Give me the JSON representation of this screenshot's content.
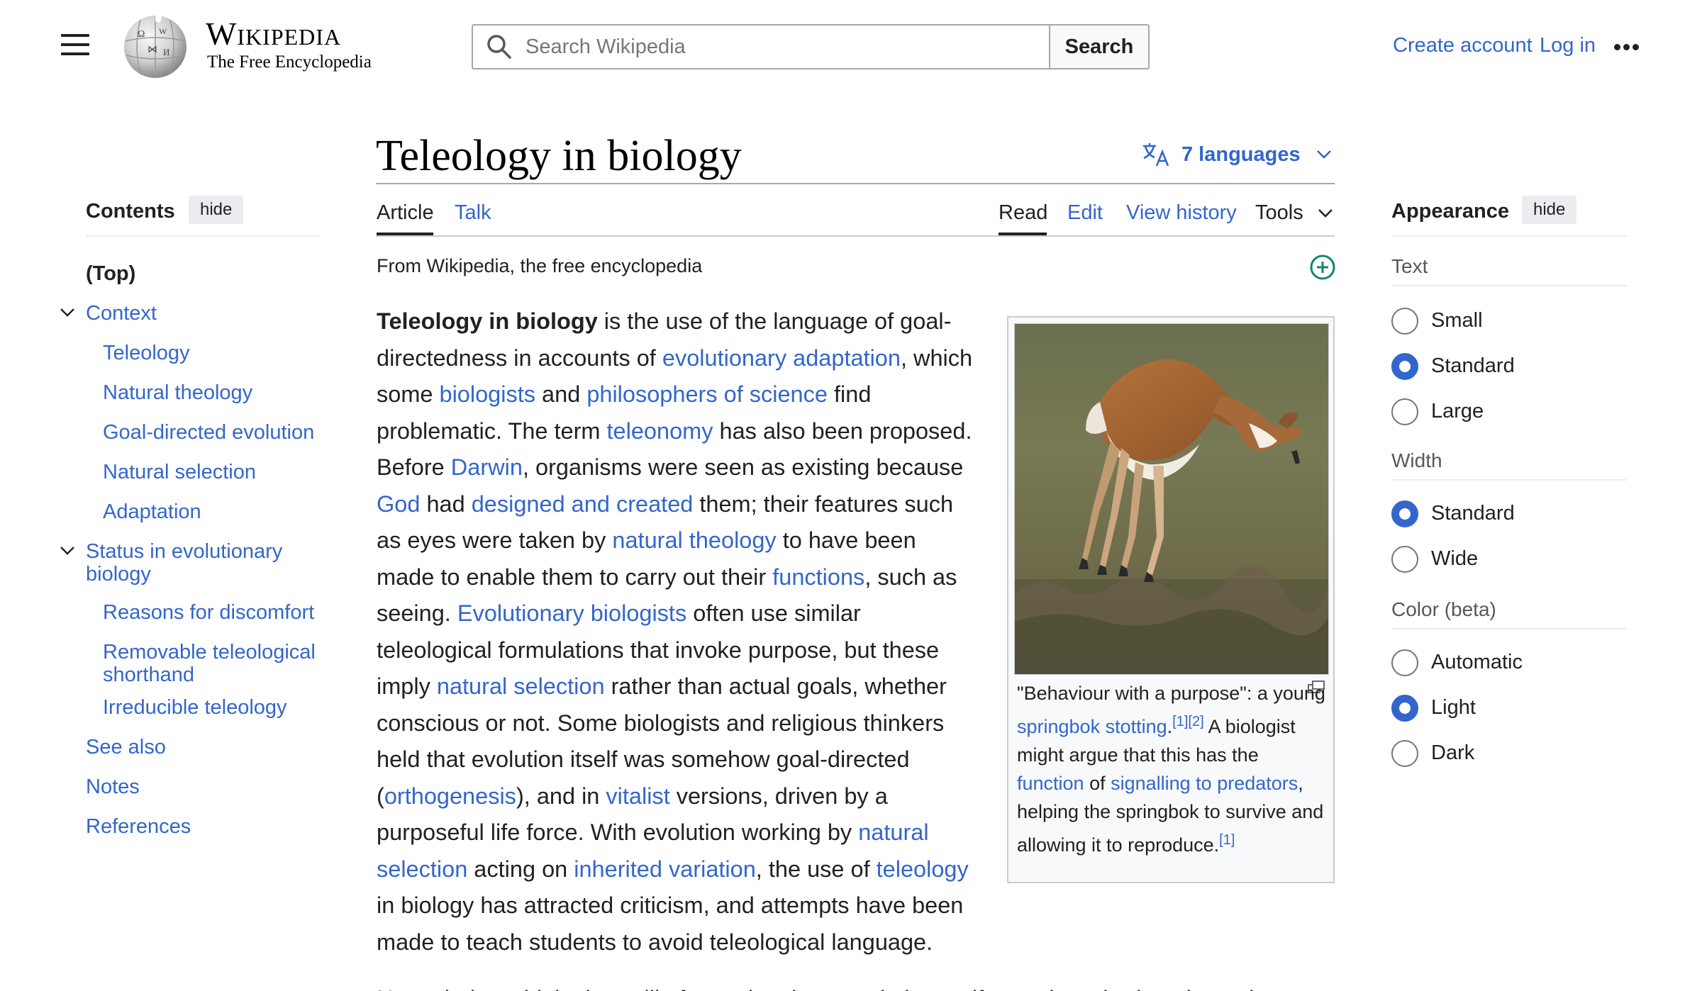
{
  "header": {
    "logo_wordmark": "Wikipedia",
    "logo_tagline": "The Free Encyclopedia",
    "search_placeholder": "Search Wikipedia",
    "search_button": "Search",
    "create_account": "Create account",
    "log_in": "Log in"
  },
  "article": {
    "title": "Teleology in biology",
    "languages": "7 languages",
    "tabs": {
      "article": "Article",
      "talk": "Talk",
      "read": "Read",
      "edit": "Edit",
      "view_history": "View history",
      "tools": "Tools"
    },
    "tagline": "From Wikipedia, the free encyclopedia",
    "lead": [
      {
        "t": "Teleology in biology",
        "b": true
      },
      {
        "t": " is the use of the language of goal-directedness in accounts of "
      },
      {
        "t": "evolutionary adaptation",
        "l": true
      },
      {
        "t": ", which some "
      },
      {
        "t": "biologists",
        "l": true
      },
      {
        "t": " and "
      },
      {
        "t": "philosophers of science",
        "l": true
      },
      {
        "t": " find problematic. The term "
      },
      {
        "t": "teleonomy",
        "l": true
      },
      {
        "t": " has also been proposed. Before "
      },
      {
        "t": "Darwin",
        "l": true
      },
      {
        "t": ", organisms were seen as existing because "
      },
      {
        "t": "God",
        "l": true
      },
      {
        "t": " had "
      },
      {
        "t": "designed and created",
        "l": true
      },
      {
        "t": " them; their features such as eyes were taken by "
      },
      {
        "t": "natural theology",
        "l": true
      },
      {
        "t": " to have been made to enable them to carry out their "
      },
      {
        "t": "functions",
        "l": true
      },
      {
        "t": ", such as seeing. "
      },
      {
        "t": "Evolutionary biologists",
        "l": true
      },
      {
        "t": " often use similar teleological formulations that invoke purpose, but these imply "
      },
      {
        "t": "natural selection",
        "l": true
      },
      {
        "t": " rather than actual goals, whether conscious or not. Some biologists and religious thinkers held that evolution itself was somehow goal-directed ("
      },
      {
        "t": "orthogenesis",
        "l": true
      },
      {
        "t": "), and in "
      },
      {
        "t": "vitalist",
        "l": true
      },
      {
        "t": " versions, driven by a purposeful life force. With evolution working by "
      },
      {
        "t": "natural selection",
        "l": true
      },
      {
        "t": " acting on "
      },
      {
        "t": "inherited variation",
        "l": true
      },
      {
        "t": ", the use of "
      },
      {
        "t": "teleology",
        "l": true
      },
      {
        "t": " in biology has attracted criticism, and attempts have been made to teach students to avoid teleological language."
      }
    ],
    "next_para": "Nevertheless, biologists still often write about evolution as if organisms had goals, and",
    "caption": [
      {
        "t": "\"Behaviour with a purpose\": a young "
      },
      {
        "t": "springbok",
        "l": true
      },
      {
        "t": " "
      },
      {
        "t": "stotting",
        "l": true
      },
      {
        "t": "."
      },
      {
        "t": "[1]",
        "sup": true
      },
      {
        "t": "[2]",
        "sup": true
      },
      {
        "t": " A biologist might argue that this has the "
      },
      {
        "t": "function",
        "l": true
      },
      {
        "t": " of "
      },
      {
        "t": "signalling to predators",
        "l": true
      },
      {
        "t": ", helping the springbok to survive and allowing it to reproduce."
      },
      {
        "t": "[1]",
        "sup": true
      }
    ]
  },
  "toc": {
    "title": "Contents",
    "hide": "hide",
    "items": [
      {
        "label": "(Top)",
        "level": 0,
        "bold": true
      },
      {
        "label": "Context",
        "level": 0,
        "expand": true
      },
      {
        "label": "Teleology",
        "level": 1
      },
      {
        "label": "Natural theology",
        "level": 1
      },
      {
        "label": "Goal-directed evolution",
        "level": 1
      },
      {
        "label": "Natural selection",
        "level": 1
      },
      {
        "label": "Adaptation",
        "level": 1
      },
      {
        "label": "Status in evolutionary biology",
        "level": 0,
        "expand": true
      },
      {
        "label": "Reasons for discomfort",
        "level": 1
      },
      {
        "label": "Removable teleological shorthand",
        "level": 1
      },
      {
        "label": "Irreducible teleology",
        "level": 1
      },
      {
        "label": "See also",
        "level": 0
      },
      {
        "label": "Notes",
        "level": 0
      },
      {
        "label": "References",
        "level": 0
      }
    ]
  },
  "appearance": {
    "title": "Appearance",
    "hide": "hide",
    "sections": [
      {
        "heading": "Text",
        "options": [
          {
            "label": "Small",
            "selected": false
          },
          {
            "label": "Standard",
            "selected": true
          },
          {
            "label": "Large",
            "selected": false
          }
        ]
      },
      {
        "heading": "Width",
        "options": [
          {
            "label": "Standard",
            "selected": true
          },
          {
            "label": "Wide",
            "selected": false
          }
        ]
      },
      {
        "heading": "Color (beta)",
        "options": [
          {
            "label": "Automatic",
            "selected": false
          },
          {
            "label": "Light",
            "selected": true
          },
          {
            "label": "Dark",
            "selected": false
          }
        ]
      }
    ]
  },
  "colors": {
    "link": "#3366cc",
    "text": "#202122",
    "accent_green": "#14866d"
  }
}
